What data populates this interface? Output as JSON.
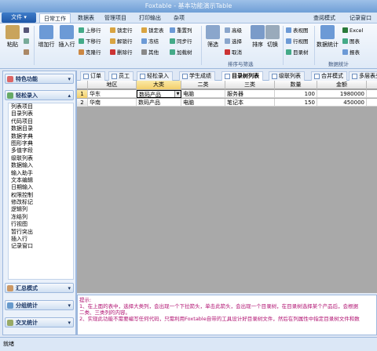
{
  "window": {
    "title": "Foxtable - 基本功能演示Table"
  },
  "menubar": {
    "file_label": "文件",
    "tabs": [
      "日常工作",
      "数据表",
      "管理项目",
      "打印输出",
      "杂项"
    ],
    "right_items": [
      "查阅模式",
      "记录窗口"
    ]
  },
  "ribbon": {
    "clipboard": {
      "paste": "粘贴",
      "group": ""
    },
    "rows": {
      "add": "增加行",
      "insert": "插入行",
      "up": "上移行",
      "down": "下移行",
      "fill": "克隆行",
      "lock": "锁定行",
      "unlock": "解锁行",
      "del": "删除行",
      "lockcol": "锁定表",
      "freeze": "冻结",
      "other": "其他"
    },
    "cols": {
      "reset": "重置列",
      "sync": "同步行",
      "addcol": "加载树"
    },
    "filter": {
      "filter": "筛选",
      "adv": "高级",
      "select": "选择",
      "cancel": "取消",
      "sort": "排序",
      "switch": "切换",
      "group": "排序与筛选"
    },
    "view": {
      "table_view": "表视图",
      "row_view": "行视图",
      "tree_view": "目录树",
      "group": ""
    },
    "stats": {
      "stats": "数据统计",
      "excel": "Excel",
      "chart": "图表",
      "report": "报表",
      "group": "数据统计"
    }
  },
  "sidebar": {
    "sections": [
      {
        "label": "特色功能"
      },
      {
        "label": "轻松录入"
      },
      {
        "label": "汇总模式"
      },
      {
        "label": "分组统计"
      },
      {
        "label": "交叉统计"
      }
    ],
    "items": [
      "列表项目",
      "目录列表",
      "代码项目",
      "数据目录",
      "数据字典",
      "图形字典",
      "多值字段",
      "级联列表",
      "数据输入",
      "输入助手",
      "文本编辑",
      "日期输入",
      "权限控制",
      "修改标记",
      "逻辑列",
      "冻结列",
      "行视图",
      "暂行突出",
      "插入行",
      "记录窗口"
    ]
  },
  "doctabs": [
    "订单",
    "员工",
    "轻松录入",
    "学生成绩",
    "目录树列表",
    "级联列表",
    "合并模式",
    "多层表头"
  ],
  "grid": {
    "headers": [
      "地区",
      "大类",
      "二类",
      "三类",
      "数量",
      "金额"
    ],
    "rows": [
      {
        "n": "1",
        "c": [
          "华东",
          "数码产品",
          "电脑",
          "服务器",
          "100",
          "1980000"
        ]
      },
      {
        "n": "2",
        "c": [
          "华南",
          "数码产品",
          "电脑",
          "笔记本",
          "150",
          "450000"
        ]
      }
    ]
  },
  "hint": {
    "title": "提示:",
    "lines": [
      "1、在上面的表中，选择大类列，会出现一个下拉箭头，单击此箭头，会出现一个目录树，在目录树选择某个产品后，会根据",
      "二类、三类列的内容。",
      "2、实现此功能不需要编写任何代码，只需利用Foxtable自带的工具设计好目录树文件，然后在列属性中指定目录树文件和数"
    ]
  },
  "status": {
    "text": "就绪"
  },
  "colors": {
    "accent": "#1f58a8",
    "selected": "#f3cf6b"
  }
}
